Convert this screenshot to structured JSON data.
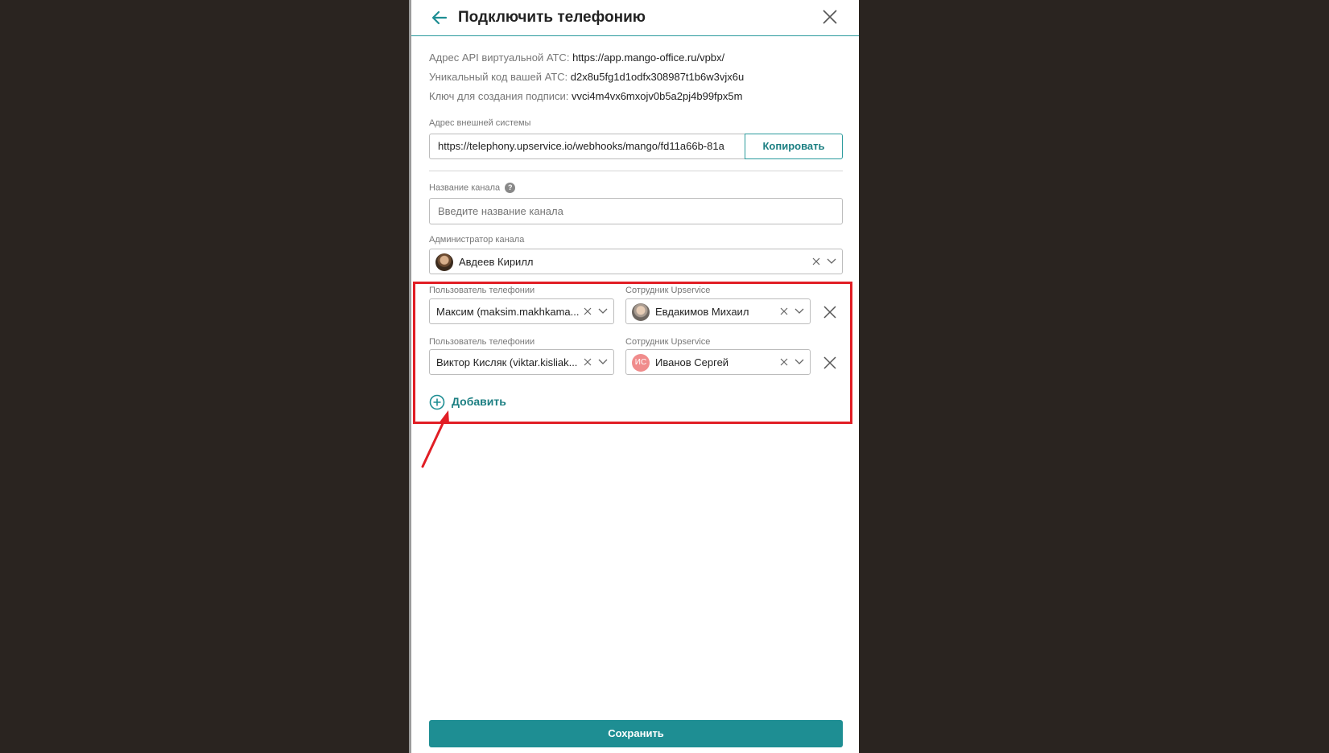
{
  "header": {
    "title": "Подключить телефонию"
  },
  "info": {
    "api_label": "Адрес API виртуальной АТС:",
    "api_value": "https://app.mango-office.ru/vpbx/",
    "code_label": "Уникальный код вашей АТС:",
    "code_value": "d2x8u5fg1d1odfx308987t1b6w3vjx6u",
    "key_label": "Ключ для создания подписи:",
    "key_value": "vvci4m4vx6mxojv0b5a2pj4b99fpx5m"
  },
  "external": {
    "label": "Адрес внешней системы",
    "value": "https://telephony.upservice.io/webhooks/mango/fd11a66b-81a",
    "copy_label": "Копировать"
  },
  "channel_name": {
    "label": "Название канала",
    "placeholder": "Введите название канала",
    "help": "?"
  },
  "admin": {
    "label": "Администратор канала",
    "value": "Авдеев Кирилл"
  },
  "mappings": [
    {
      "user_label": "Пользователь телефонии",
      "user_value": "Максим (maksim.makhkama...",
      "employee_label": "Сотрудник Upservice",
      "employee_value": "Евдакимов Михаил"
    },
    {
      "user_label": "Пользователь телефонии",
      "user_value": "Виктор Кисляк (viktar.kisliak...",
      "employee_label": "Сотрудник Upservice",
      "employee_value": "Иванов Сергей",
      "employee_initials": "ИС"
    }
  ],
  "add_label": "Добавить",
  "save_label": "Сохранить",
  "colors": {
    "accent": "#1e8e93",
    "highlight": "#e11e25",
    "backdrop": "#2a2420"
  }
}
